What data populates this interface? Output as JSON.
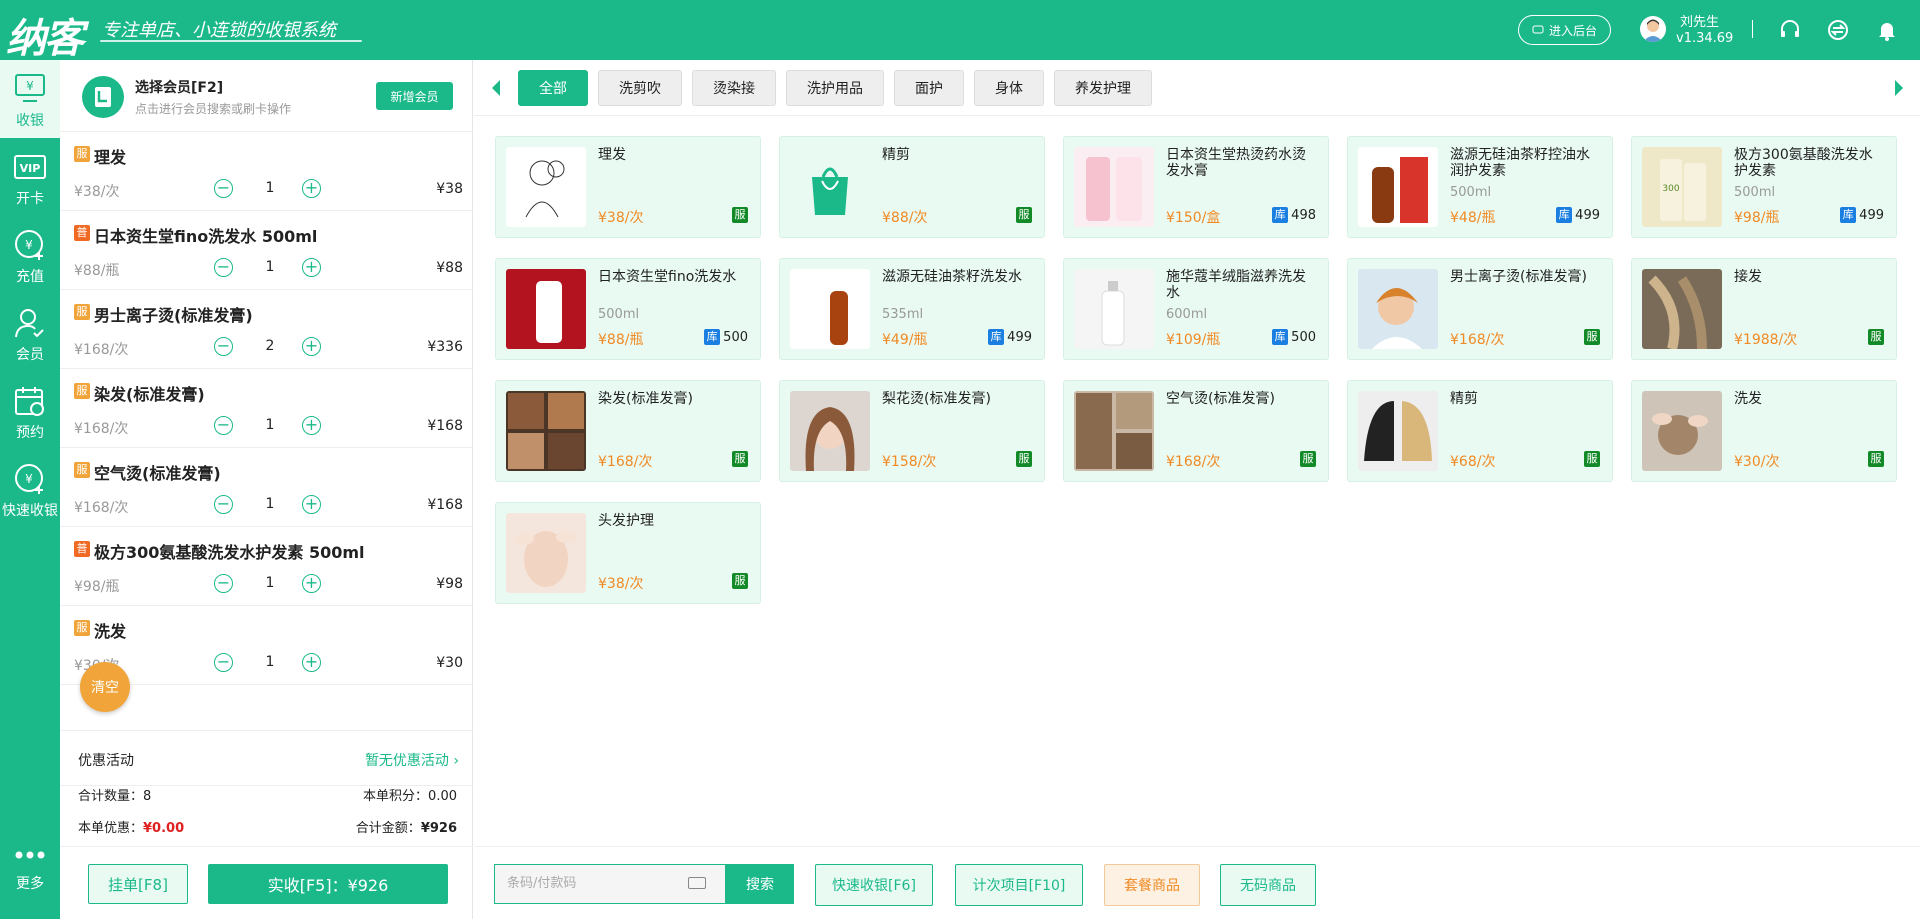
{
  "header": {
    "logo": "纳客",
    "slogan": "专注单店、小连锁的收银系统",
    "admin_button": "进入后台",
    "user_name": "刘先生",
    "version": "v1.34.69"
  },
  "sidebar": {
    "items": [
      {
        "label": "收银",
        "icon": "cashier-icon"
      },
      {
        "label": "开卡",
        "icon": "vip-card-icon"
      },
      {
        "label": "充值",
        "icon": "recharge-icon"
      },
      {
        "label": "会员",
        "icon": "member-icon"
      },
      {
        "label": "预约",
        "icon": "calendar-icon"
      },
      {
        "label": "快速收银",
        "icon": "quick-cash-icon"
      },
      {
        "label": "更多",
        "icon": "more-icon"
      }
    ]
  },
  "member": {
    "title": "选择会员[F2]",
    "subtitle": "点击进行会员搜索或刷卡操作",
    "new_button": "新增会员"
  },
  "cart": {
    "items": [
      {
        "badge": "服",
        "badge_color": "#f0a43a",
        "name": "理发",
        "price": "¥38/次",
        "qty": "1",
        "total": "¥38"
      },
      {
        "badge": "普",
        "badge_color": "#f06a24",
        "name": "日本资生堂fino洗发水 500ml",
        "price": "¥88/瓶",
        "qty": "1",
        "total": "¥88"
      },
      {
        "badge": "服",
        "badge_color": "#f0a43a",
        "name": "男士离子烫(标准发膏)",
        "price": "¥168/次",
        "qty": "2",
        "total": "¥336"
      },
      {
        "badge": "服",
        "badge_color": "#f0a43a",
        "name": "染发(标准发膏)",
        "price": "¥168/次",
        "qty": "1",
        "total": "¥168"
      },
      {
        "badge": "服",
        "badge_color": "#f0a43a",
        "name": "空气烫(标准发膏)",
        "price": "¥168/次",
        "qty": "1",
        "total": "¥168"
      },
      {
        "badge": "普",
        "badge_color": "#f06a24",
        "name": "极方300氨基酸洗发水护发素 500ml",
        "price": "¥98/瓶",
        "qty": "1",
        "total": "¥98"
      },
      {
        "badge": "服",
        "badge_color": "#f0a43a",
        "name": "洗发",
        "price": "¥30/次",
        "qty": "1",
        "total": "¥30"
      }
    ],
    "clear_button": "清空",
    "promo_label": "优惠活动",
    "promo_value": "暂无优惠活动 ›",
    "qty_label": "合计数量：8",
    "points_label": "本单积分：0.00",
    "discount_label": "本单优惠：",
    "discount_value": "¥0.00",
    "total_label": "合计金额：",
    "total_value": "¥926",
    "hang_button": "挂单[F8]",
    "pay_button": "实收[F5]：¥926"
  },
  "categories": [
    "全部",
    "洗剪吹",
    "烫染接",
    "洗护用品",
    "面护",
    "身体",
    "养发护理"
  ],
  "products": [
    {
      "name": "理发",
      "spec": "",
      "price": "¥38/次",
      "tag": "服",
      "stock": ""
    },
    {
      "name": "精剪",
      "spec": "",
      "price": "¥88/次",
      "tag": "服",
      "stock": ""
    },
    {
      "name": "日本资生堂热烫药水烫发水膏",
      "spec": "",
      "price": "¥150/盒",
      "tag": "库",
      "stock": "498"
    },
    {
      "name": "滋源无硅油茶籽控油水润护发素",
      "spec": "500ml",
      "price": "¥48/瓶",
      "tag": "库",
      "stock": "499"
    },
    {
      "name": "极方300氨基酸洗发水护发素",
      "spec": "500ml",
      "price": "¥98/瓶",
      "tag": "库",
      "stock": "499"
    },
    {
      "name": "日本资生堂fino洗发水",
      "spec": "500ml",
      "price": "¥88/瓶",
      "tag": "库",
      "stock": "500"
    },
    {
      "name": "滋源无硅油茶籽洗发水",
      "spec": "535ml",
      "price": "¥49/瓶",
      "tag": "库",
      "stock": "499"
    },
    {
      "name": "施华蔻羊绒脂滋养洗发水",
      "spec": "600ml",
      "price": "¥109/瓶",
      "tag": "库",
      "stock": "500"
    },
    {
      "name": "男士离子烫(标准发膏)",
      "spec": "",
      "price": "¥168/次",
      "tag": "服",
      "stock": ""
    },
    {
      "name": "接发",
      "spec": "",
      "price": "¥1988/次",
      "tag": "服",
      "stock": ""
    },
    {
      "name": "染发(标准发膏)",
      "spec": "",
      "price": "¥168/次",
      "tag": "服",
      "stock": ""
    },
    {
      "name": "梨花烫(标准发膏)",
      "spec": "",
      "price": "¥158/次",
      "tag": "服",
      "stock": ""
    },
    {
      "name": "空气烫(标准发膏)",
      "spec": "",
      "price": "¥168/次",
      "tag": "服",
      "stock": ""
    },
    {
      "name": "精剪",
      "spec": "",
      "price": "¥68/次",
      "tag": "服",
      "stock": ""
    },
    {
      "name": "洗发",
      "spec": "",
      "price": "¥30/次",
      "tag": "服",
      "stock": ""
    },
    {
      "name": "头发护理",
      "spec": "",
      "price": "¥38/次",
      "tag": "服",
      "stock": ""
    }
  ],
  "bottom": {
    "search_placeholder": "条码/付款码",
    "search_button": "搜索",
    "quick_button": "快速收银[F6]",
    "count_button": "计次项目[F10]",
    "package_button": "套餐商品",
    "nocode_button": "无码商品"
  },
  "colors": {
    "brand": "#1bb98a",
    "price": "#f08a24",
    "service_tag": "#138a28",
    "stock_tag": "#1a7fe0"
  }
}
